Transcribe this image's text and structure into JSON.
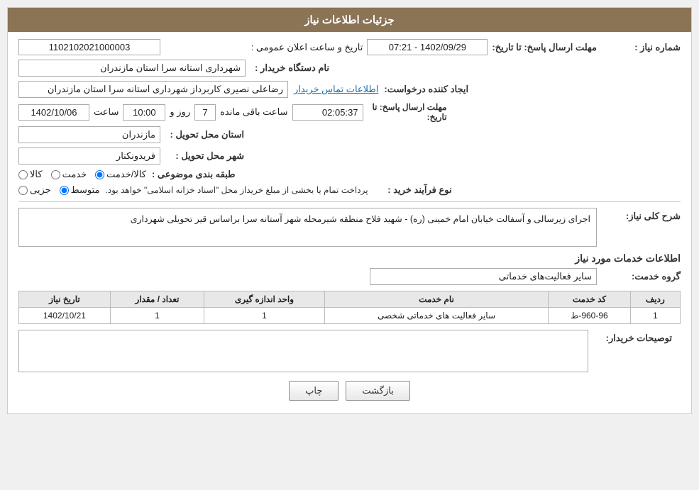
{
  "header": {
    "title": "جزئیات اطلاعات نیاز"
  },
  "fields": {
    "shomara_label": "شماره نیاز :",
    "shomara_value": "1102102021000003",
    "nam_dastgah_label": "نام دستگاه خریدار :",
    "nam_dastgah_value": "شهرداری استانه سرا استان مازندران",
    "ijad_konande_label": "ایجاد کننده درخواست:",
    "ijad_konande_value": "رضاعلی نصیری کاربرداز شهرداری استانه سرا استان مازندران",
    "ijad_konande_link": "اطلاعات تماس خریدار",
    "mohlet_label": "مهلت ارسال پاسخ: تا تاریخ:",
    "date_value": "1402/10/06",
    "saat_label": "ساعت",
    "saat_value": "10:00",
    "roz_label": "روز و",
    "roz_value": "7",
    "mande_value": "02:05:37",
    "mande_label": "ساعت باقی مانده",
    "ostan_label": "استان محل تحویل :",
    "ostan_value": "مازندران",
    "shahr_label": "شهر محل تحویل :",
    "shahr_value": "فریدونکنار",
    "tabaqe_label": "طبقه بندی موضوعی :",
    "tabaqe_options": [
      "کالا",
      "خدمت",
      "کالا/خدمت"
    ],
    "tabaqe_selected": "کالا/خدمت",
    "noie_label": "نوع فرآیند خرید :",
    "noie_options": [
      "جزیی",
      "متوسط"
    ],
    "noie_selected": "متوسط",
    "noie_extra": "پرداخت تمام یا بخشی از مبلغ خریداز محل \"اسناد خزانه اسلامی\" خواهد بود.",
    "sharh_label": "شرح کلی نیاز:",
    "sharh_value": "اجرای زیرسالی و آسفالت خیابان امام خمینی (ره) - شهید فلاح منطقه شیرمحله شهر آستانه سرا براساس قیر تحویلی شهرداری",
    "khadamat_title": "اطلاعات خدمات مورد نیاز",
    "grouh_label": "گروه خدمت:",
    "grouh_value": "سایر فعالیت‌های خدماتی",
    "table": {
      "headers": [
        "ردیف",
        "کد خدمت",
        "نام خدمت",
        "واحد اندازه گیری",
        "تعداد / مقدار",
        "تاریخ نیاز"
      ],
      "rows": [
        {
          "radif": "1",
          "kod": "960-96-ط",
          "nam": "سایر فعالیت های خدماتی شخصی",
          "vahed": "1",
          "tedad": "1",
          "tarikh": "1402/10/21"
        }
      ]
    },
    "buyer_desc_label": "توصیحات خریدار:",
    "buyer_desc_value": "",
    "buttons": {
      "print": "چاپ",
      "back": "بازگشت"
    }
  }
}
